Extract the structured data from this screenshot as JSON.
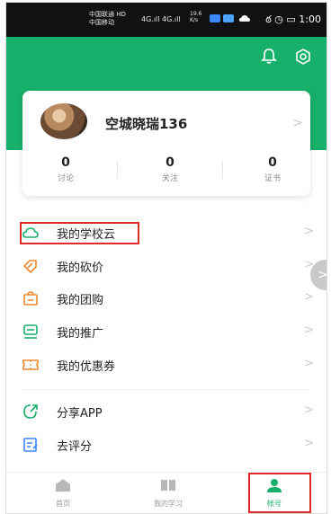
{
  "status_bar": {
    "carrier_line1": "中国联通 HD",
    "carrier_line2": "中国移动",
    "signal": "4G.ıll  4G.ıll",
    "speed_value": "19.6",
    "speed_unit": "K/s",
    "alarm_icons": "ఠ ◷ ▭",
    "time": "1:00"
  },
  "header": {
    "bell_icon": "bell-icon",
    "settings_icon": "settings-icon",
    "accent_color": "#17b06a"
  },
  "profile": {
    "username": "空城晓瑞136",
    "arrow": ">",
    "stats": [
      {
        "value": "0",
        "label": "讨论"
      },
      {
        "value": "0",
        "label": "关注"
      },
      {
        "value": "0",
        "label": "证书"
      }
    ]
  },
  "menu": {
    "arrow": ">",
    "items": [
      {
        "label": "我的学校云",
        "icon": "cloud-icon"
      },
      {
        "label": "我的砍价",
        "icon": "tag-icon"
      },
      {
        "label": "我的团购",
        "icon": "bag-icon"
      },
      {
        "label": "我的推广",
        "icon": "promotion-icon"
      },
      {
        "label": "我的优惠券",
        "icon": "coupon-icon"
      },
      {
        "label": "分享APP",
        "icon": "share-icon"
      },
      {
        "label": "去评分",
        "icon": "rate-icon"
      }
    ]
  },
  "side_bubble": ">",
  "nav": {
    "items": [
      {
        "label": "首页",
        "icon": "home-icon"
      },
      {
        "label": "我的学习",
        "icon": "book-icon"
      },
      {
        "label": "帐号",
        "icon": "user-icon",
        "active": true
      }
    ]
  },
  "highlight_color": "#e02a2a"
}
